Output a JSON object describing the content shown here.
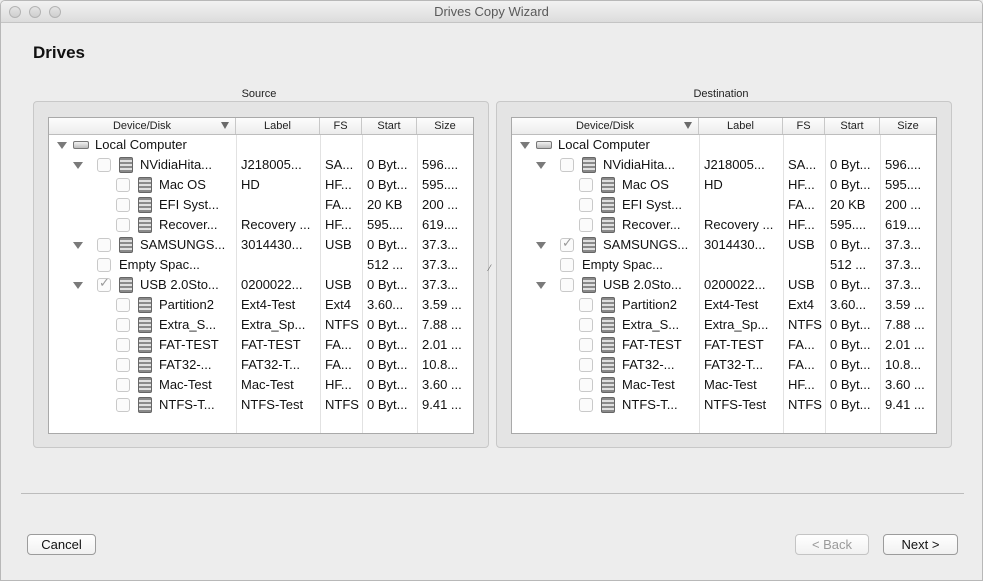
{
  "window": {
    "title": "Drives Copy Wizard"
  },
  "page": {
    "title": "Drives"
  },
  "columns": [
    "Device/Disk",
    "Label",
    "FS",
    "Start",
    "Size"
  ],
  "source": {
    "label": "Source",
    "rows": [
      {
        "level": 0,
        "type": "computer",
        "expand": true,
        "checkbox": false,
        "checked": false,
        "name": "Local Computer",
        "label": "",
        "fs": "",
        "start": "",
        "size": ""
      },
      {
        "level": 1,
        "type": "disk",
        "expand": true,
        "checkbox": true,
        "checked": false,
        "name": "NVidiaHita...",
        "label": "J218005...",
        "fs": "SA...",
        "start": "0 Byt...",
        "size": "596...."
      },
      {
        "level": 2,
        "type": "disk",
        "expand": false,
        "checkbox": true,
        "checked": false,
        "name": "Mac OS",
        "label": "HD",
        "fs": "HF...",
        "start": "0 Byt...",
        "size": "595...."
      },
      {
        "level": 2,
        "type": "disk",
        "expand": false,
        "checkbox": true,
        "checked": false,
        "name": "EFI Syst...",
        "label": "",
        "fs": "FA...",
        "start": "20 KB",
        "size": "200 ..."
      },
      {
        "level": 2,
        "type": "disk",
        "expand": false,
        "checkbox": true,
        "checked": false,
        "name": "Recover...",
        "label": "Recovery ...",
        "fs": "HF...",
        "start": "595....",
        "size": "619...."
      },
      {
        "level": 1,
        "type": "disk",
        "expand": true,
        "checkbox": true,
        "checked": false,
        "name": "SAMSUNGS...",
        "label": "3014430...",
        "fs": "USB",
        "start": "0 Byt...",
        "size": "37.3..."
      },
      {
        "level": 2,
        "type": "space",
        "expand": false,
        "checkbox": true,
        "checked": false,
        "name": "Empty Spac...",
        "label": "",
        "fs": "",
        "start": "512 ...",
        "size": "37.3..."
      },
      {
        "level": 1,
        "type": "disk",
        "expand": true,
        "checkbox": true,
        "checked": true,
        "name": "USB 2.0Sto...",
        "label": "0200022...",
        "fs": "USB",
        "start": "0 Byt...",
        "size": "37.3..."
      },
      {
        "level": 2,
        "type": "disk",
        "expand": false,
        "checkbox": true,
        "checked": false,
        "name": "Partition2",
        "label": "Ext4-Test",
        "fs": "Ext4",
        "start": "3.60...",
        "size": "3.59 ..."
      },
      {
        "level": 2,
        "type": "disk",
        "expand": false,
        "checkbox": true,
        "checked": false,
        "name": "Extra_S...",
        "label": "Extra_Sp...",
        "fs": "NTFS",
        "start": "0 Byt...",
        "size": "7.88 ..."
      },
      {
        "level": 2,
        "type": "disk",
        "expand": false,
        "checkbox": true,
        "checked": false,
        "name": "FAT-TEST",
        "label": "FAT-TEST",
        "fs": "FA...",
        "start": "0 Byt...",
        "size": "2.01 ..."
      },
      {
        "level": 2,
        "type": "disk",
        "expand": false,
        "checkbox": true,
        "checked": false,
        "name": "FAT32-...",
        "label": "FAT32-T...",
        "fs": "FA...",
        "start": "0 Byt...",
        "size": "10.8..."
      },
      {
        "level": 2,
        "type": "disk",
        "expand": false,
        "checkbox": true,
        "checked": false,
        "name": "Mac-Test",
        "label": "Mac-Test",
        "fs": "HF...",
        "start": "0 Byt...",
        "size": "3.60 ..."
      },
      {
        "level": 2,
        "type": "disk",
        "expand": false,
        "checkbox": true,
        "checked": false,
        "name": "NTFS-T...",
        "label": "NTFS-Test",
        "fs": "NTFS",
        "start": "0 Byt...",
        "size": "9.41 ..."
      }
    ]
  },
  "destination": {
    "label": "Destination",
    "rows": [
      {
        "level": 0,
        "type": "computer",
        "expand": true,
        "checkbox": false,
        "checked": false,
        "name": "Local Computer",
        "label": "",
        "fs": "",
        "start": "",
        "size": ""
      },
      {
        "level": 1,
        "type": "disk",
        "expand": true,
        "checkbox": true,
        "checked": false,
        "name": "NVidiaHita...",
        "label": "J218005...",
        "fs": "SA...",
        "start": "0 Byt...",
        "size": "596...."
      },
      {
        "level": 2,
        "type": "disk",
        "expand": false,
        "checkbox": true,
        "checked": false,
        "name": "Mac OS",
        "label": "HD",
        "fs": "HF...",
        "start": "0 Byt...",
        "size": "595...."
      },
      {
        "level": 2,
        "type": "disk",
        "expand": false,
        "checkbox": true,
        "checked": false,
        "name": "EFI Syst...",
        "label": "",
        "fs": "FA...",
        "start": "20 KB",
        "size": "200 ..."
      },
      {
        "level": 2,
        "type": "disk",
        "expand": false,
        "checkbox": true,
        "checked": false,
        "name": "Recover...",
        "label": "Recovery ...",
        "fs": "HF...",
        "start": "595....",
        "size": "619...."
      },
      {
        "level": 1,
        "type": "disk",
        "expand": true,
        "checkbox": true,
        "checked": true,
        "name": "SAMSUNGS...",
        "label": "3014430...",
        "fs": "USB",
        "start": "0 Byt...",
        "size": "37.3..."
      },
      {
        "level": 2,
        "type": "space",
        "expand": false,
        "checkbox": true,
        "checked": false,
        "name": "Empty Spac...",
        "label": "",
        "fs": "",
        "start": "512 ...",
        "size": "37.3..."
      },
      {
        "level": 1,
        "type": "disk",
        "expand": true,
        "checkbox": true,
        "checked": false,
        "name": "USB 2.0Sto...",
        "label": "0200022...",
        "fs": "USB",
        "start": "0 Byt...",
        "size": "37.3..."
      },
      {
        "level": 2,
        "type": "disk",
        "expand": false,
        "checkbox": true,
        "checked": false,
        "name": "Partition2",
        "label": "Ext4-Test",
        "fs": "Ext4",
        "start": "3.60...",
        "size": "3.59 ..."
      },
      {
        "level": 2,
        "type": "disk",
        "expand": false,
        "checkbox": true,
        "checked": false,
        "name": "Extra_S...",
        "label": "Extra_Sp...",
        "fs": "NTFS",
        "start": "0 Byt...",
        "size": "7.88 ..."
      },
      {
        "level": 2,
        "type": "disk",
        "expand": false,
        "checkbox": true,
        "checked": false,
        "name": "FAT-TEST",
        "label": "FAT-TEST",
        "fs": "FA...",
        "start": "0 Byt...",
        "size": "2.01 ..."
      },
      {
        "level": 2,
        "type": "disk",
        "expand": false,
        "checkbox": true,
        "checked": false,
        "name": "FAT32-...",
        "label": "FAT32-T...",
        "fs": "FA...",
        "start": "0 Byt...",
        "size": "10.8..."
      },
      {
        "level": 2,
        "type": "disk",
        "expand": false,
        "checkbox": true,
        "checked": false,
        "name": "Mac-Test",
        "label": "Mac-Test",
        "fs": "HF...",
        "start": "0 Byt...",
        "size": "3.60 ..."
      },
      {
        "level": 2,
        "type": "disk",
        "expand": false,
        "checkbox": true,
        "checked": false,
        "name": "NTFS-T...",
        "label": "NTFS-Test",
        "fs": "NTFS",
        "start": "0 Byt...",
        "size": "9.41 ..."
      }
    ]
  },
  "buttons": {
    "cancel": "Cancel",
    "back": "< Back",
    "next": "Next >"
  }
}
